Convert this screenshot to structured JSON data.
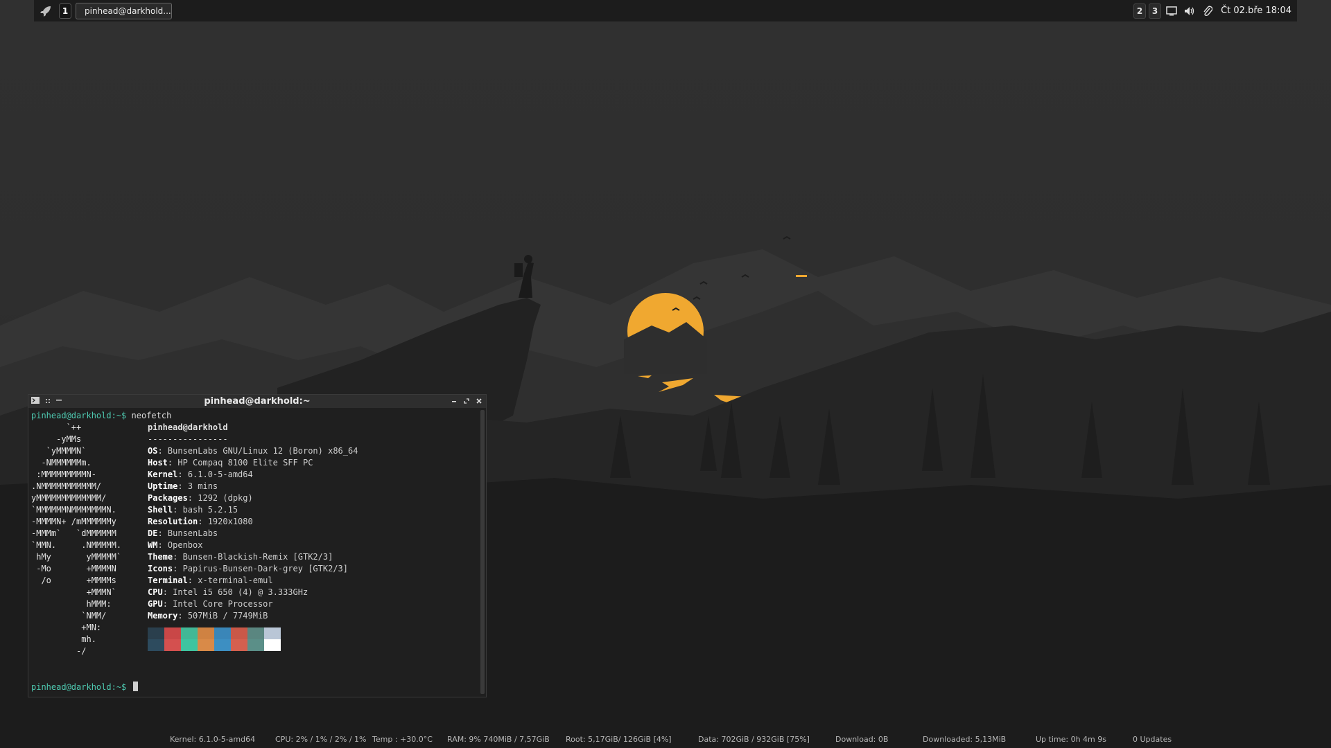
{
  "panel": {
    "workspaces": [
      "1",
      "2",
      "3"
    ],
    "task_title": "pinhead@darkhold...",
    "clock": "Čt 02.bře 18:04"
  },
  "terminal": {
    "title": "pinhead@darkhold:~",
    "prompt": "pinhead@darkhold:~$",
    "command": "neofetch",
    "logo": [
      "       `++",
      "     -yMMs",
      "   `yMMMMN`",
      "  -NMMMMMMm.",
      " :MMMMMMMMMN-",
      ".NMMMMMMMMMMM/",
      "yMMMMMMMMMMMMM/",
      "`MMMMMMNMMMMMMMN.",
      "-MMMMN+ /mMMMMMMy",
      "-MMMm`   `dMMMMMM",
      "`MMN.     .NMMMMM.",
      " hMy       yMMMMM`",
      " -Mo       +MMMMN",
      "  /o       +MMMMs",
      "           +MMMN`",
      "           hMMM:",
      "          `NMM/",
      "          +MN:",
      "          mh.",
      "         -/"
    ],
    "header": "pinhead@darkhold",
    "separator": "----------------",
    "info": [
      {
        "key": "OS",
        "val": "BunsenLabs GNU/Linux 12 (Boron) x86_64"
      },
      {
        "key": "Host",
        "val": "HP Compaq 8100 Elite SFF PC"
      },
      {
        "key": "Kernel",
        "val": "6.1.0-5-amd64"
      },
      {
        "key": "Uptime",
        "val": "3 mins"
      },
      {
        "key": "Packages",
        "val": "1292 (dpkg)"
      },
      {
        "key": "Shell",
        "val": "bash 5.2.15"
      },
      {
        "key": "Resolution",
        "val": "1920x1080"
      },
      {
        "key": "DE",
        "val": "BunsenLabs"
      },
      {
        "key": "WM",
        "val": "Openbox"
      },
      {
        "key": "Theme",
        "val": "Bunsen-Blackish-Remix [GTK2/3]"
      },
      {
        "key": "Icons",
        "val": "Papirus-Bunsen-Dark-grey [GTK2/3]"
      },
      {
        "key": "Terminal",
        "val": "x-terminal-emul"
      },
      {
        "key": "CPU",
        "val": "Intel i5 650 (4) @ 3.333GHz"
      },
      {
        "key": "GPU",
        "val": "Intel Core Processor"
      },
      {
        "key": "Memory",
        "val": "507MiB / 7749MiB"
      }
    ],
    "colors": [
      "#2d4b5e",
      "#d4504f",
      "#3fc4a0",
      "#d98a48",
      "#3d8fc2",
      "#d4604f",
      "#5b8f88",
      "#ffffff"
    ],
    "colors_top": [
      "#2a3f4d",
      "#c94747",
      "#42b896",
      "#cf8242",
      "#3a86b8",
      "#c95848",
      "#5a8680",
      "#b9c6d6"
    ]
  },
  "conky": {
    "kernel": "Kernel: 6.1.0-5-amd64",
    "cpu": "CPU: 2% / 1% / 2% / 1%",
    "temp": "Temp : +30.0°C",
    "ram": "RAM: 9%  740MiB  / 7,57GiB",
    "root": "Root: 5,17GiB/ 126GiB  [4%]",
    "data": "Data: 702GiB / 932GiB  [75%]",
    "download": "Download: 0B",
    "downloaded": "Downloaded: 5,13MiB",
    "uptime": "Up time: 0h 4m 9s",
    "updates": "0 Updates"
  },
  "accent": "#f0a830"
}
